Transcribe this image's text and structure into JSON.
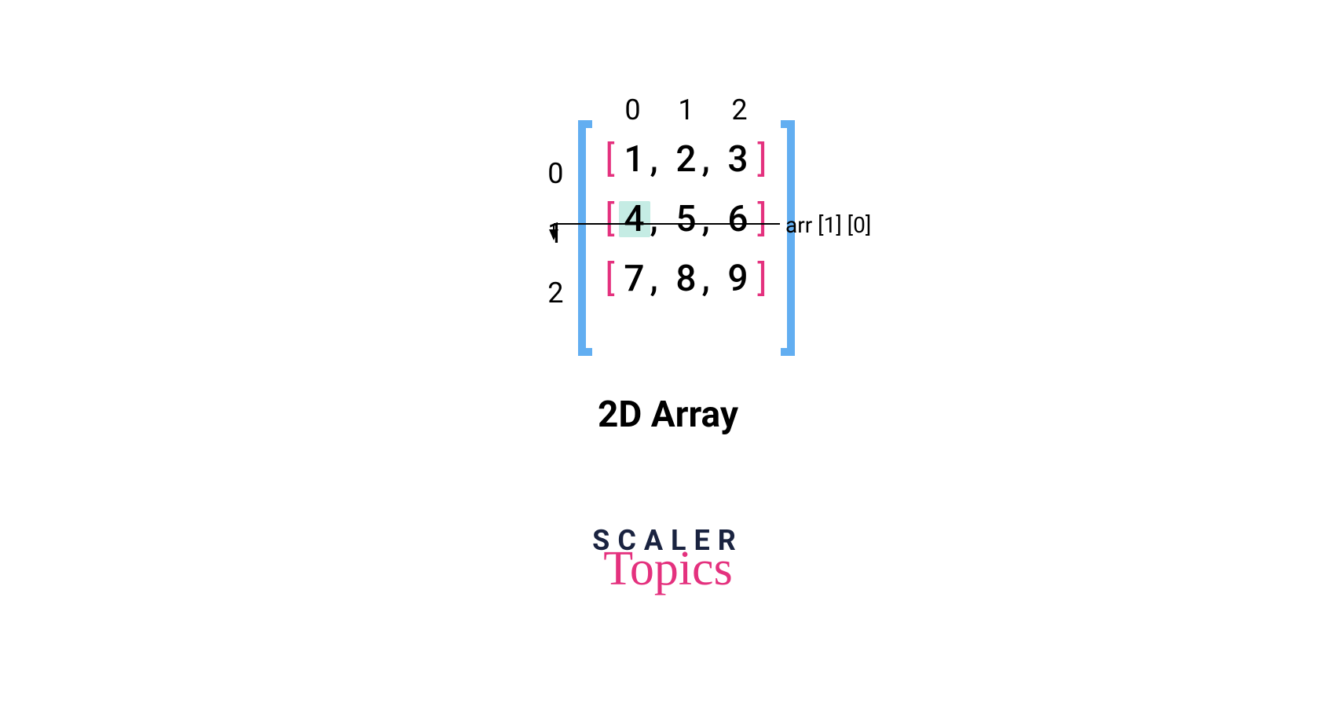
{
  "colors": {
    "outer_bracket": "#62aef1",
    "inner_bracket": "#e4317e",
    "highlight_bg": "#c5ece4",
    "logo_dark": "#1a2340",
    "logo_accent": "#e4317e"
  },
  "column_indices": [
    "0",
    "1",
    "2"
  ],
  "row_indices": [
    "0",
    "1",
    "2"
  ],
  "rows": [
    {
      "values": [
        "1",
        "2",
        "3"
      ]
    },
    {
      "values": [
        "4",
        "5",
        "6"
      ]
    },
    {
      "values": [
        "7",
        "8",
        "9"
      ]
    }
  ],
  "highlighted_cell": {
    "row": 1,
    "col": 0
  },
  "annotation_label": "arr [1] [0]",
  "title": "2D Array",
  "logo": {
    "line1": "SCALER",
    "line2": "Topics"
  }
}
